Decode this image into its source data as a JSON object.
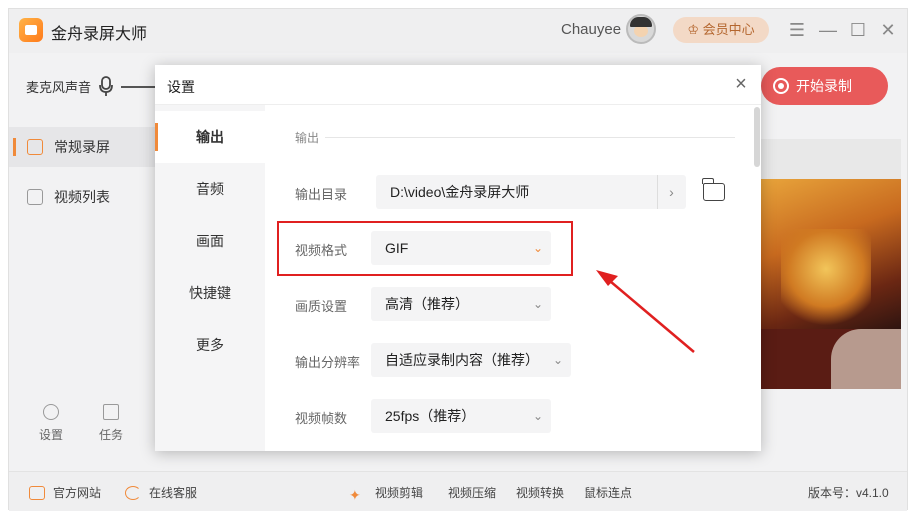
{
  "app": {
    "title": "金舟录屏大师",
    "user_name": "Chauyee",
    "vip_label": "会员中心",
    "mic_label": "麦克风声音",
    "start_label": "开始录制",
    "nav": [
      {
        "label": "常规录屏"
      },
      {
        "label": "视频列表"
      }
    ],
    "tools": {
      "settings": "设置",
      "tasks": "任务"
    }
  },
  "statusbar": {
    "website": "官方网站",
    "support": "在线客服",
    "edit": "视频剪辑",
    "compress": "视频压缩",
    "convert": "视频转换",
    "click": "鼠标连点",
    "version": "版本号：v4.1.0"
  },
  "dialog": {
    "title": "设置",
    "tabs": [
      {
        "label": "输出"
      },
      {
        "label": "音频"
      },
      {
        "label": "画面"
      },
      {
        "label": "快捷键"
      },
      {
        "label": "更多"
      }
    ],
    "section": "输出",
    "output_dir_label": "输出目录",
    "output_dir_value": "D:\\video\\金舟录屏大师",
    "format_label": "视频格式",
    "format_value": "GIF",
    "quality_label": "画质设置",
    "quality_value": "高清（推荐）",
    "resolution_label": "输出分辨率",
    "resolution_value": "自适应录制内容（推荐）",
    "fps_label": "视频帧数",
    "fps_value": "25fps（推荐）"
  },
  "colors": {
    "accent": "#f08a3a",
    "record_button": "#e85a5a",
    "highlight": "#e02020"
  }
}
